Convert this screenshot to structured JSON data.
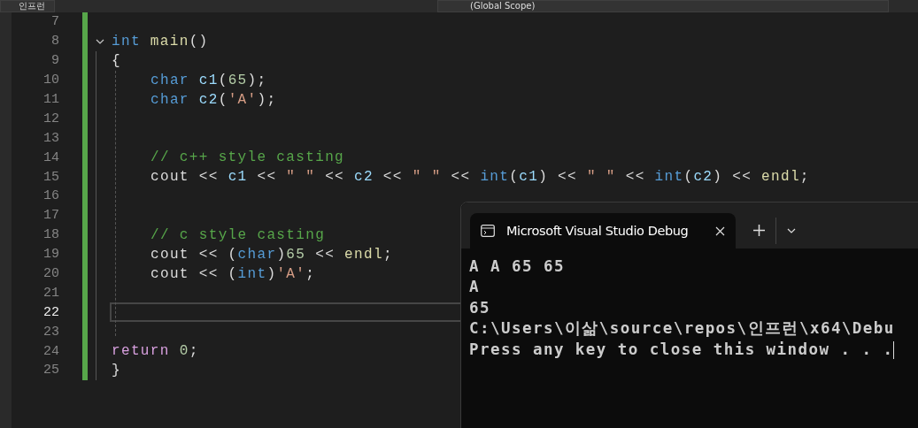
{
  "top_bar": {
    "project": "인프런",
    "scope": "(Global Scope)"
  },
  "editor": {
    "lines": [
      {
        "number": "7",
        "current": false
      },
      {
        "number": "8",
        "current": false,
        "foldable": true,
        "tokens": [
          {
            "kind": "kw",
            "text": "int "
          },
          {
            "kind": "fn",
            "text": "main"
          },
          {
            "kind": "txt",
            "text": "()"
          }
        ]
      },
      {
        "number": "9",
        "current": false,
        "tokens": [
          {
            "kind": "txt",
            "text": "{"
          }
        ],
        "children": [
          {
            "number": "10",
            "current": false,
            "tokens": [
              {
                "kind": "kw",
                "text": "char "
              },
              {
                "kind": "var",
                "text": "c1"
              },
              {
                "kind": "txt",
                "text": "("
              },
              {
                "kind": "num",
                "text": "65"
              },
              {
                "kind": "txt",
                "text": ");"
              }
            ]
          },
          {
            "number": "11",
            "current": false,
            "tokens": [
              {
                "kind": "kw",
                "text": "char "
              },
              {
                "kind": "var",
                "text": "c2"
              },
              {
                "kind": "txt",
                "text": "("
              },
              {
                "kind": "str",
                "text": "'A'"
              },
              {
                "kind": "txt",
                "text": ");"
              }
            ]
          },
          {
            "number": "12",
            "current": false
          },
          {
            "number": "13",
            "current": false
          },
          {
            "number": "14",
            "current": false,
            "tokens": [
              {
                "kind": "cm",
                "text": "// c++ style casting"
              }
            ]
          },
          {
            "number": "15",
            "current": false,
            "tokens": [
              {
                "kind": "txt",
                "text": "cout << "
              },
              {
                "kind": "var",
                "text": "c1"
              },
              {
                "kind": "txt",
                "text": " << "
              },
              {
                "kind": "str",
                "text": "\" \""
              },
              {
                "kind": "txt",
                "text": " << "
              },
              {
                "kind": "var",
                "text": "c2"
              },
              {
                "kind": "txt",
                "text": " << "
              },
              {
                "kind": "str",
                "text": "\" \""
              },
              {
                "kind": "txt",
                "text": " << "
              },
              {
                "kind": "kw",
                "text": "int"
              },
              {
                "kind": "txt",
                "text": "("
              },
              {
                "kind": "var",
                "text": "c1"
              },
              {
                "kind": "txt",
                "text": ") << "
              },
              {
                "kind": "str",
                "text": "\" \""
              },
              {
                "kind": "txt",
                "text": " << "
              },
              {
                "kind": "kw",
                "text": "int"
              },
              {
                "kind": "txt",
                "text": "("
              },
              {
                "kind": "var",
                "text": "c2"
              },
              {
                "kind": "txt",
                "text": ") << "
              },
              {
                "kind": "fn",
                "text": "endl"
              },
              {
                "kind": "txt",
                "text": ";"
              }
            ]
          },
          {
            "number": "16",
            "current": false
          },
          {
            "number": "17",
            "current": false
          },
          {
            "number": "18",
            "current": false,
            "tokens": [
              {
                "kind": "cm",
                "text": "// c style casting"
              }
            ]
          },
          {
            "number": "19",
            "current": false,
            "tokens": [
              {
                "kind": "txt",
                "text": "cout << ("
              },
              {
                "kind": "kw",
                "text": "char"
              },
              {
                "kind": "txt",
                "text": ")"
              },
              {
                "kind": "num",
                "text": "65"
              },
              {
                "kind": "txt",
                "text": " << "
              },
              {
                "kind": "fn",
                "text": "endl"
              },
              {
                "kind": "txt",
                "text": ";"
              }
            ]
          },
          {
            "number": "20",
            "current": false,
            "tokens": [
              {
                "kind": "txt",
                "text": "cout << ("
              },
              {
                "kind": "kw",
                "text": "int"
              },
              {
                "kind": "txt",
                "text": ")"
              },
              {
                "kind": "str",
                "text": "'A'"
              },
              {
                "kind": "txt",
                "text": ";"
              }
            ]
          },
          {
            "number": "21",
            "current": false
          },
          {
            "number": "22",
            "current": true
          },
          {
            "number": "23",
            "current": false
          }
        ]
      },
      {
        "number": "24",
        "current": false,
        "tokens": [
          {
            "kind": "ctl",
            "text": "return "
          },
          {
            "kind": "num",
            "text": "0"
          },
          {
            "kind": "txt",
            "text": ";"
          }
        ]
      },
      {
        "number": "25",
        "current": false,
        "tokens": [
          {
            "kind": "txt",
            "text": "}"
          }
        ]
      }
    ]
  },
  "terminal": {
    "tab": {
      "title": "Microsoft Visual Studio Debug",
      "selected": true
    },
    "output": [
      "A A 65 65",
      "A",
      "65",
      "C:\\Users\\이삶\\source\\repos\\인프런\\x64\\Debu",
      "Press any key to close this window . . ."
    ]
  }
}
